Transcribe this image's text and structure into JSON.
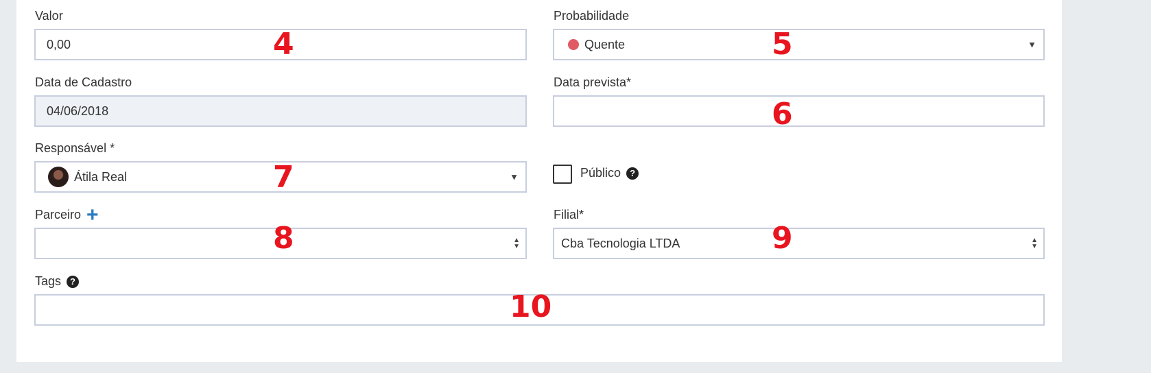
{
  "form": {
    "valor": {
      "label": "Valor",
      "value": "0,00",
      "marker": "4"
    },
    "probabilidade": {
      "label": "Probabilidade",
      "value": "Quente",
      "dot_color": "#e05a63",
      "marker": "5"
    },
    "data_cadastro": {
      "label": "Data de Cadastro",
      "value": "04/06/2018"
    },
    "data_prevista": {
      "label": "Data prevista*",
      "value": "",
      "marker": "6"
    },
    "responsavel": {
      "label": "Responsável *",
      "value": "Átila Real",
      "marker": "7"
    },
    "publico": {
      "label": "Público",
      "checked": false
    },
    "parceiro": {
      "label": "Parceiro",
      "value": "",
      "marker": "8"
    },
    "filial": {
      "label": "Filial*",
      "value": "Cba Tecnologia LTDA",
      "marker": "9"
    },
    "tags": {
      "label": "Tags",
      "value": "",
      "marker": "10"
    }
  },
  "icons": {
    "dropdown_caret": "▼",
    "help": "?",
    "plus": "+",
    "spinner_up": "▲",
    "spinner_down": "▼"
  },
  "colors": {
    "accent_blue": "#2b7bc1",
    "marker_red": "#e8141e",
    "disabled_bg": "#eef1f5",
    "border": "#c8cede"
  }
}
